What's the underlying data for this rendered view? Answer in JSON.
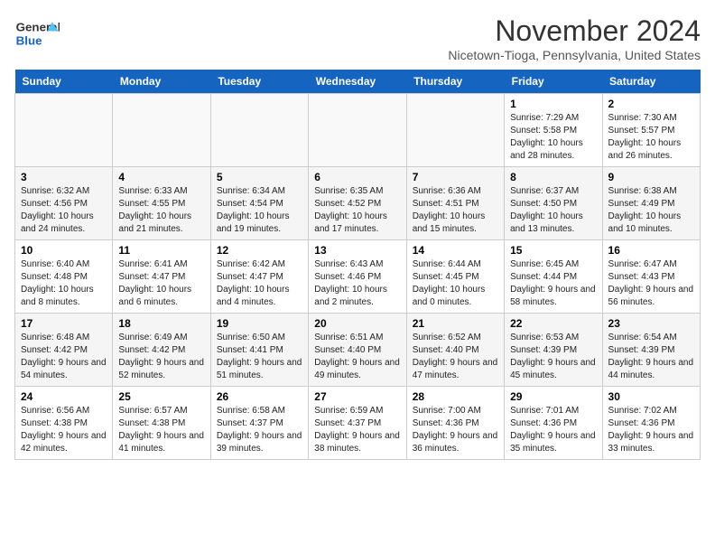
{
  "header": {
    "logo_line1": "General",
    "logo_line2": "Blue",
    "month": "November 2024",
    "location": "Nicetown-Tioga, Pennsylvania, United States"
  },
  "days_of_week": [
    "Sunday",
    "Monday",
    "Tuesday",
    "Wednesday",
    "Thursday",
    "Friday",
    "Saturday"
  ],
  "weeks": [
    [
      {
        "day": "",
        "info": ""
      },
      {
        "day": "",
        "info": ""
      },
      {
        "day": "",
        "info": ""
      },
      {
        "day": "",
        "info": ""
      },
      {
        "day": "",
        "info": ""
      },
      {
        "day": "1",
        "info": "Sunrise: 7:29 AM\nSunset: 5:58 PM\nDaylight: 10 hours and 28 minutes."
      },
      {
        "day": "2",
        "info": "Sunrise: 7:30 AM\nSunset: 5:57 PM\nDaylight: 10 hours and 26 minutes."
      }
    ],
    [
      {
        "day": "3",
        "info": "Sunrise: 6:32 AM\nSunset: 4:56 PM\nDaylight: 10 hours and 24 minutes."
      },
      {
        "day": "4",
        "info": "Sunrise: 6:33 AM\nSunset: 4:55 PM\nDaylight: 10 hours and 21 minutes."
      },
      {
        "day": "5",
        "info": "Sunrise: 6:34 AM\nSunset: 4:54 PM\nDaylight: 10 hours and 19 minutes."
      },
      {
        "day": "6",
        "info": "Sunrise: 6:35 AM\nSunset: 4:52 PM\nDaylight: 10 hours and 17 minutes."
      },
      {
        "day": "7",
        "info": "Sunrise: 6:36 AM\nSunset: 4:51 PM\nDaylight: 10 hours and 15 minutes."
      },
      {
        "day": "8",
        "info": "Sunrise: 6:37 AM\nSunset: 4:50 PM\nDaylight: 10 hours and 13 minutes."
      },
      {
        "day": "9",
        "info": "Sunrise: 6:38 AM\nSunset: 4:49 PM\nDaylight: 10 hours and 10 minutes."
      }
    ],
    [
      {
        "day": "10",
        "info": "Sunrise: 6:40 AM\nSunset: 4:48 PM\nDaylight: 10 hours and 8 minutes."
      },
      {
        "day": "11",
        "info": "Sunrise: 6:41 AM\nSunset: 4:47 PM\nDaylight: 10 hours and 6 minutes."
      },
      {
        "day": "12",
        "info": "Sunrise: 6:42 AM\nSunset: 4:47 PM\nDaylight: 10 hours and 4 minutes."
      },
      {
        "day": "13",
        "info": "Sunrise: 6:43 AM\nSunset: 4:46 PM\nDaylight: 10 hours and 2 minutes."
      },
      {
        "day": "14",
        "info": "Sunrise: 6:44 AM\nSunset: 4:45 PM\nDaylight: 10 hours and 0 minutes."
      },
      {
        "day": "15",
        "info": "Sunrise: 6:45 AM\nSunset: 4:44 PM\nDaylight: 9 hours and 58 minutes."
      },
      {
        "day": "16",
        "info": "Sunrise: 6:47 AM\nSunset: 4:43 PM\nDaylight: 9 hours and 56 minutes."
      }
    ],
    [
      {
        "day": "17",
        "info": "Sunrise: 6:48 AM\nSunset: 4:42 PM\nDaylight: 9 hours and 54 minutes."
      },
      {
        "day": "18",
        "info": "Sunrise: 6:49 AM\nSunset: 4:42 PM\nDaylight: 9 hours and 52 minutes."
      },
      {
        "day": "19",
        "info": "Sunrise: 6:50 AM\nSunset: 4:41 PM\nDaylight: 9 hours and 51 minutes."
      },
      {
        "day": "20",
        "info": "Sunrise: 6:51 AM\nSunset: 4:40 PM\nDaylight: 9 hours and 49 minutes."
      },
      {
        "day": "21",
        "info": "Sunrise: 6:52 AM\nSunset: 4:40 PM\nDaylight: 9 hours and 47 minutes."
      },
      {
        "day": "22",
        "info": "Sunrise: 6:53 AM\nSunset: 4:39 PM\nDaylight: 9 hours and 45 minutes."
      },
      {
        "day": "23",
        "info": "Sunrise: 6:54 AM\nSunset: 4:39 PM\nDaylight: 9 hours and 44 minutes."
      }
    ],
    [
      {
        "day": "24",
        "info": "Sunrise: 6:56 AM\nSunset: 4:38 PM\nDaylight: 9 hours and 42 minutes."
      },
      {
        "day": "25",
        "info": "Sunrise: 6:57 AM\nSunset: 4:38 PM\nDaylight: 9 hours and 41 minutes."
      },
      {
        "day": "26",
        "info": "Sunrise: 6:58 AM\nSunset: 4:37 PM\nDaylight: 9 hours and 39 minutes."
      },
      {
        "day": "27",
        "info": "Sunrise: 6:59 AM\nSunset: 4:37 PM\nDaylight: 9 hours and 38 minutes."
      },
      {
        "day": "28",
        "info": "Sunrise: 7:00 AM\nSunset: 4:36 PM\nDaylight: 9 hours and 36 minutes."
      },
      {
        "day": "29",
        "info": "Sunrise: 7:01 AM\nSunset: 4:36 PM\nDaylight: 9 hours and 35 minutes."
      },
      {
        "day": "30",
        "info": "Sunrise: 7:02 AM\nSunset: 4:36 PM\nDaylight: 9 hours and 33 minutes."
      }
    ]
  ]
}
